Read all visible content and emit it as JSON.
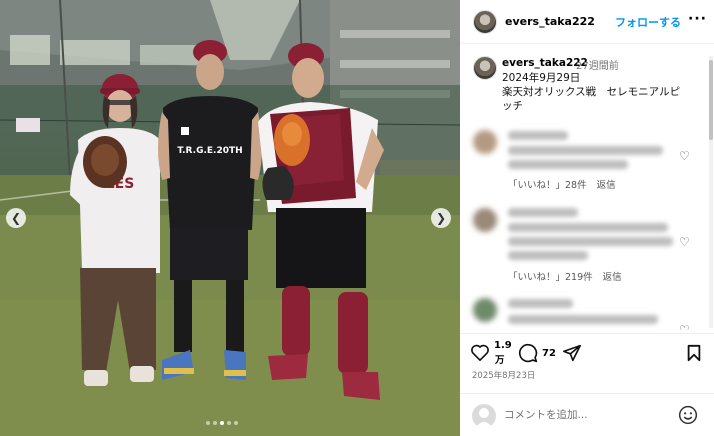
{
  "post": {
    "username": "evers_taka222",
    "follow_label": "フォローする",
    "more_label": "···"
  },
  "photo": {
    "shirt_text_left": "TEN\nLES",
    "shirt_text_center": "T.R.G.E.20TH",
    "carousel_count": 5,
    "carousel_active": 2
  },
  "caption": {
    "username": "evers_taka222",
    "time": "27週間前",
    "lines": [
      "2024年9月29日",
      "楽天対オリックス戦　セレモニアルピ",
      "ッチ"
    ]
  },
  "comments": [
    {
      "likes_label": "「いいね！」28件",
      "reply_label": "返信"
    },
    {
      "likes_label": "「いいね！」219件",
      "reply_label": "返信"
    },
    {
      "likes_label": "",
      "reply_label": ""
    }
  ],
  "actions": {
    "like_count_line1": "1.9",
    "like_count_line2": "万",
    "comment_count": "72",
    "date": "2025年8月23日"
  },
  "comment_bar": {
    "placeholder": "コメントを追加..."
  },
  "colors": {
    "accent": "#0095f6",
    "cap_color": "#8b1f34",
    "jersey": "#f1eef0"
  }
}
